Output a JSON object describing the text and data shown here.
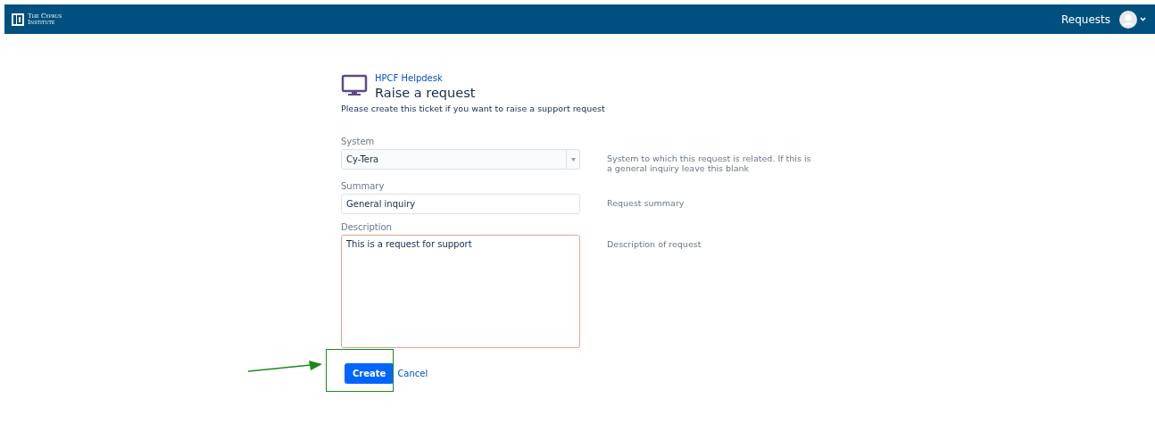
{
  "header": {
    "logo_lines": [
      "The Cyprus",
      "Institute"
    ],
    "nav_link": "Requests"
  },
  "portal": {
    "name": "HPCF Helpdesk",
    "title": "Raise a request",
    "description": "Please create this ticket if you want to raise a support request"
  },
  "fields": [
    {
      "kind": "select",
      "label": "System",
      "value": "Cy-Tera",
      "help": "System to which this request is related. If this is a general inquiry leave this blank",
      "focused": false
    },
    {
      "kind": "text",
      "label": "Summary",
      "value": "General inquiry",
      "help": "Request summary",
      "focused": false
    },
    {
      "kind": "textarea",
      "label": "Description",
      "value": "This is a request for support",
      "help": "Description of request",
      "focused": true
    }
  ],
  "buttons": {
    "submit": "Create",
    "cancel": "Cancel"
  }
}
